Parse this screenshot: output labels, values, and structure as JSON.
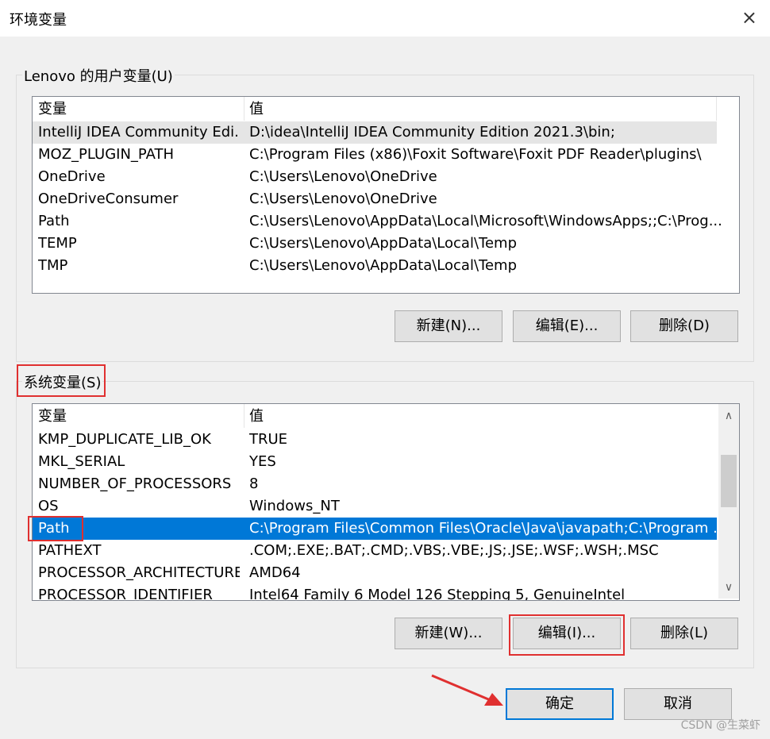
{
  "window": {
    "title": "环境变量",
    "close_icon": "×"
  },
  "user_vars": {
    "group_label": "Lenovo 的用户变量(U)",
    "col_name": "变量",
    "col_value": "值",
    "rows": [
      {
        "name": "IntelliJ IDEA Community Edi...",
        "value": "D:\\idea\\IntelliJ IDEA Community Edition 2021.3\\bin;"
      },
      {
        "name": "MOZ_PLUGIN_PATH",
        "value": "C:\\Program Files (x86)\\Foxit Software\\Foxit PDF Reader\\plugins\\"
      },
      {
        "name": "OneDrive",
        "value": "C:\\Users\\Lenovo\\OneDrive"
      },
      {
        "name": "OneDriveConsumer",
        "value": "C:\\Users\\Lenovo\\OneDrive"
      },
      {
        "name": "Path",
        "value": "C:\\Users\\Lenovo\\AppData\\Local\\Microsoft\\WindowsApps;;C:\\Prog..."
      },
      {
        "name": "TEMP",
        "value": "C:\\Users\\Lenovo\\AppData\\Local\\Temp"
      },
      {
        "name": "TMP",
        "value": "C:\\Users\\Lenovo\\AppData\\Local\\Temp"
      }
    ],
    "buttons": {
      "new": "新建(N)...",
      "edit": "编辑(E)...",
      "delete": "删除(D)"
    }
  },
  "sys_vars": {
    "group_label": "系统变量(S)",
    "col_name": "变量",
    "col_value": "值",
    "rows": [
      {
        "name": "KMP_DUPLICATE_LIB_OK",
        "value": "TRUE"
      },
      {
        "name": "MKL_SERIAL",
        "value": "YES"
      },
      {
        "name": "NUMBER_OF_PROCESSORS",
        "value": "8"
      },
      {
        "name": "OS",
        "value": "Windows_NT"
      },
      {
        "name": "Path",
        "value": "C:\\Program Files\\Common Files\\Oracle\\Java\\javapath;C:\\Program ..."
      },
      {
        "name": "PATHEXT",
        "value": ".COM;.EXE;.BAT;.CMD;.VBS;.VBE;.JS;.JSE;.WSF;.WSH;.MSC"
      },
      {
        "name": "PROCESSOR_ARCHITECTURE",
        "value": "AMD64"
      },
      {
        "name": "PROCESSOR_IDENTIFIER",
        "value": "Intel64 Family 6 Model 126 Stepping 5, GenuineIntel"
      }
    ],
    "buttons": {
      "new": "新建(W)...",
      "edit": "编辑(I)...",
      "delete": "删除(L)"
    },
    "scroll_up_icon": "∧",
    "scroll_down_icon": "∨"
  },
  "footer": {
    "ok": "确定",
    "cancel": "取消"
  },
  "watermark": "CSDN @生菜虾",
  "colors": {
    "selection": "#0078d7",
    "highlight_row": "#e5e5e5",
    "annotation_red": "#e03030"
  }
}
